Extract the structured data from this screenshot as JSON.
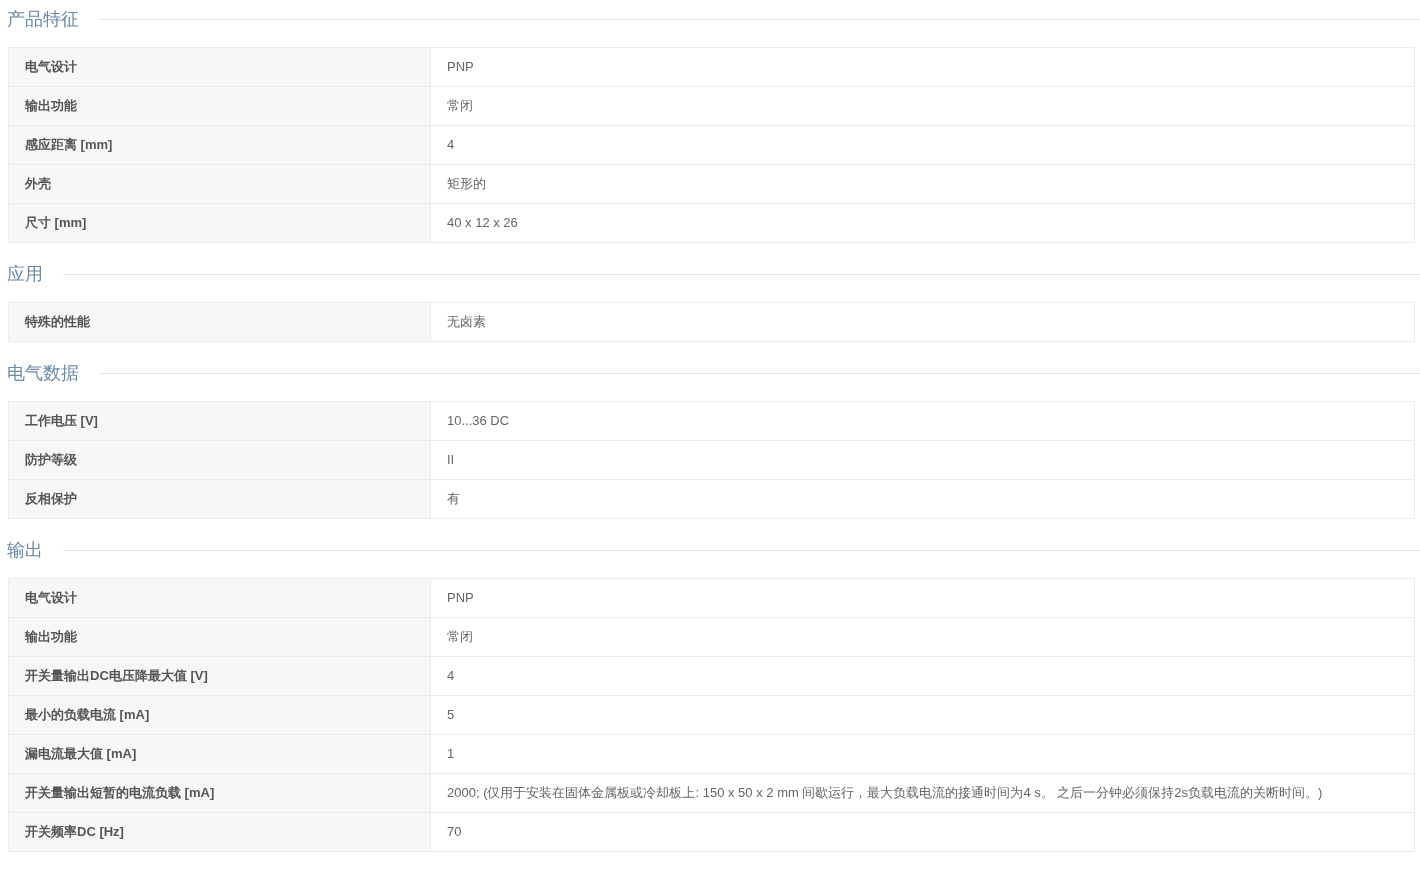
{
  "sections": [
    {
      "title": "产品特征",
      "rows": [
        {
          "label": "电气设计",
          "value": "PNP"
        },
        {
          "label": "输出功能",
          "value": "常闭"
        },
        {
          "label": "感应距离 [mm]",
          "value": "4"
        },
        {
          "label": "外壳",
          "value": "矩形的"
        },
        {
          "label": "尺寸 [mm]",
          "value": "40 x 12 x 26"
        }
      ]
    },
    {
      "title": "应用",
      "rows": [
        {
          "label": "特殊的性能",
          "value": "无卤素"
        }
      ]
    },
    {
      "title": "电气数据",
      "rows": [
        {
          "label": "工作电压 [V]",
          "value": "10...36 DC"
        },
        {
          "label": "防护等级",
          "value": "II"
        },
        {
          "label": "反相保护",
          "value": "有"
        }
      ]
    },
    {
      "title": "输出",
      "rows": [
        {
          "label": "电气设计",
          "value": "PNP"
        },
        {
          "label": "输出功能",
          "value": "常闭"
        },
        {
          "label": "开关量输出DC电压降最大值 [V]",
          "value": "4"
        },
        {
          "label": "最小的负载电流 [mA]",
          "value": "5"
        },
        {
          "label": "漏电流最大值 [mA]",
          "value": "1"
        },
        {
          "label": "开关量输出短暂的电流负载 [mA]",
          "value": "2000; (仅用于安装在固体金属板或冷却板上: 150 x 50 x 2 mm 间歇运行，最大负载电流的接通时间为4 s。 之后一分钟必须保持2s负载电流的关断时间。)"
        },
        {
          "label": "开关频率DC [Hz]",
          "value": "70"
        }
      ]
    }
  ]
}
